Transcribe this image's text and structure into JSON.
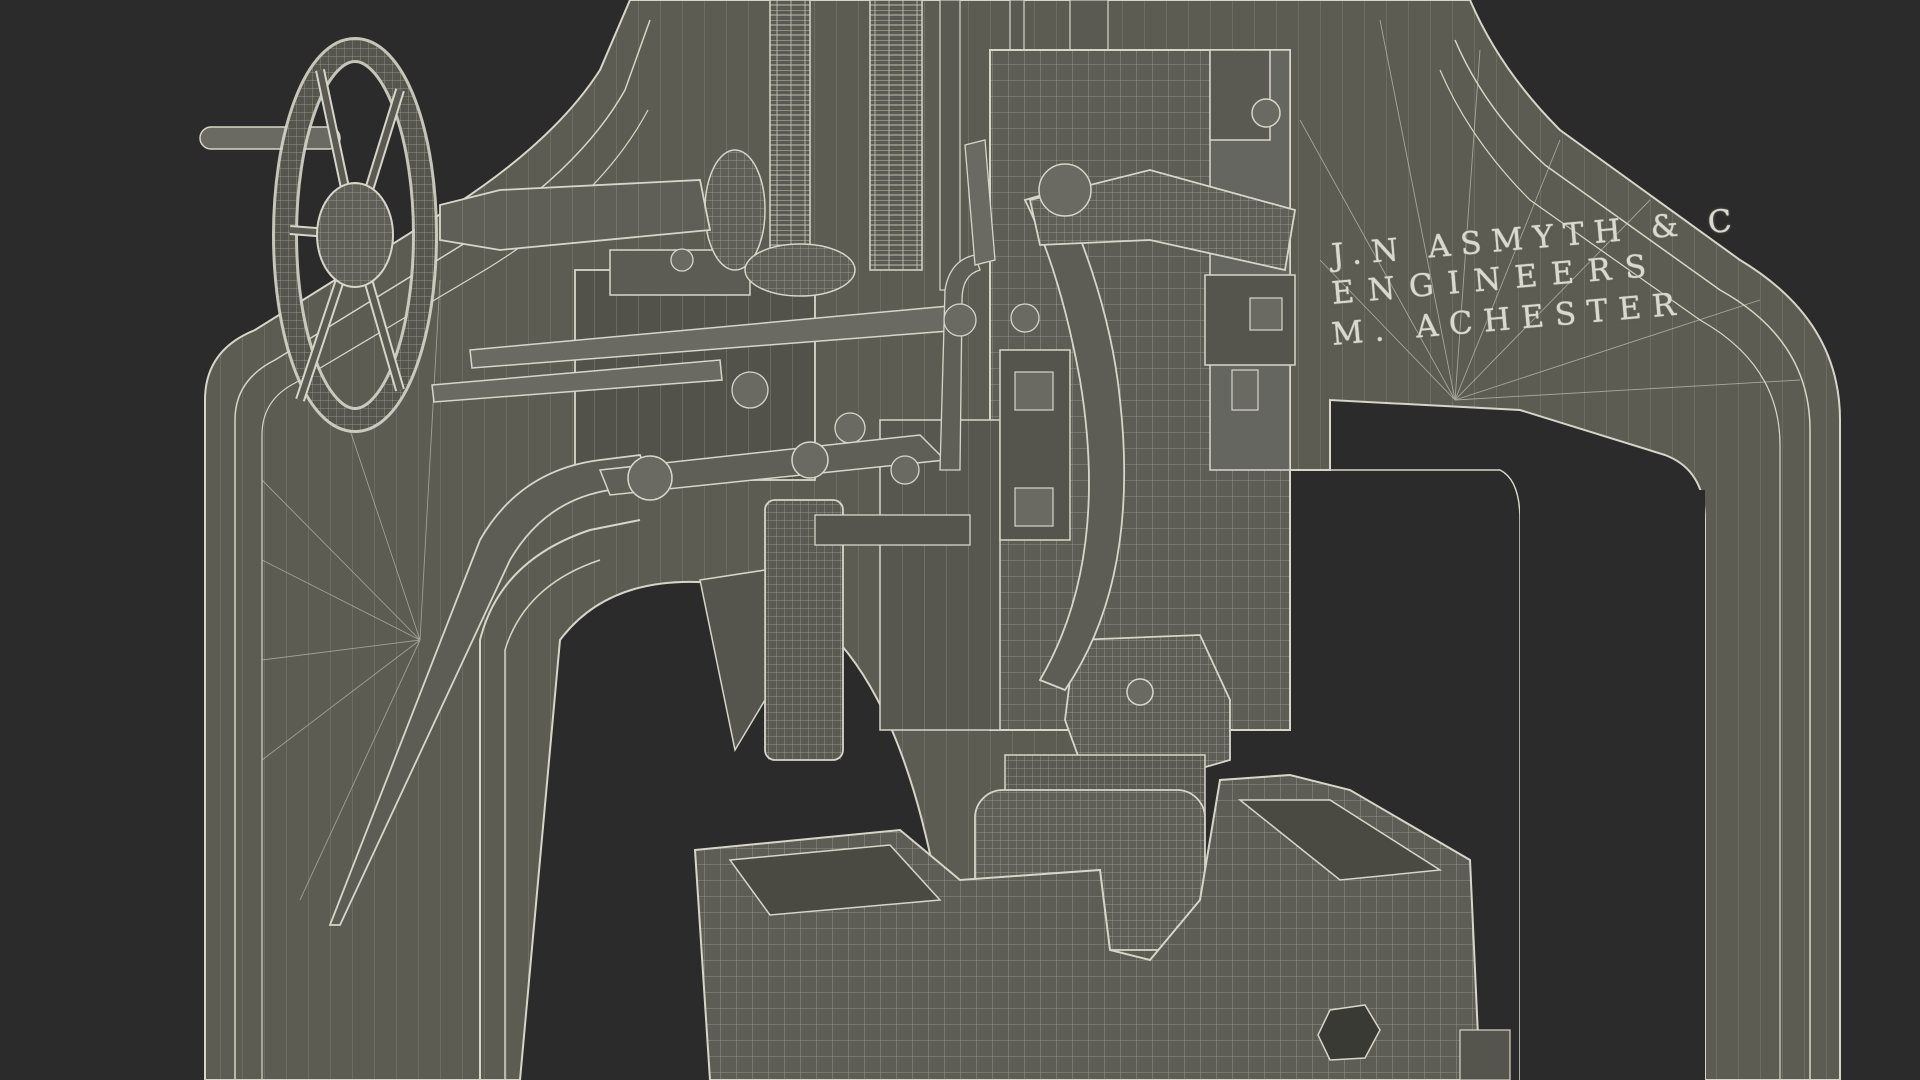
{
  "scene": {
    "background": "#2b2b2b",
    "mesh_fill": "#5f5f56",
    "mesh_dark": "#4a4a42",
    "wire_color": "#d6d6c8"
  },
  "inscription": {
    "line1": "J.N ASMYTH & C",
    "line2": "ENGINEERS",
    "line3": "M. ACHESTER"
  }
}
